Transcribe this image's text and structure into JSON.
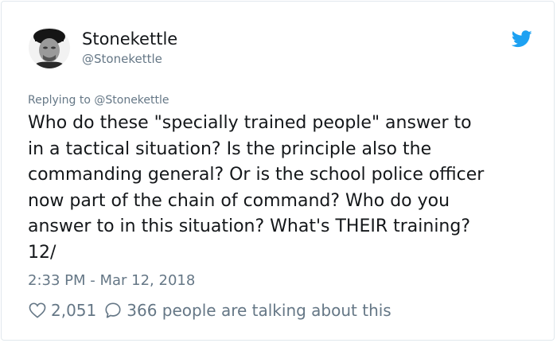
{
  "user": {
    "display_name": "Stonekettle",
    "handle": "@Stonekettle"
  },
  "reply": {
    "text": "Replying to @Stonekettle"
  },
  "tweet": {
    "lines": [
      "Who do these \"specially trained people\" answer to",
      "in a tactical situation? Is the principle also the",
      "commanding general? Or is the school police officer",
      "now part of the chain of command? Who do you",
      "answer to in this situation? What's THEIR training?",
      "12/"
    ],
    "timestamp": "2:33 PM - Mar 12, 2018"
  },
  "stats": {
    "likes": "2,051",
    "talking": "366 people are talking about this"
  },
  "colors": {
    "twitter_blue": "#1da1f2",
    "secondary_text": "#657786",
    "primary_text": "#14171a"
  },
  "icons": {
    "brand": "twitter-bird-icon",
    "like": "heart-outline-icon",
    "talk": "speech-bubble-icon"
  }
}
